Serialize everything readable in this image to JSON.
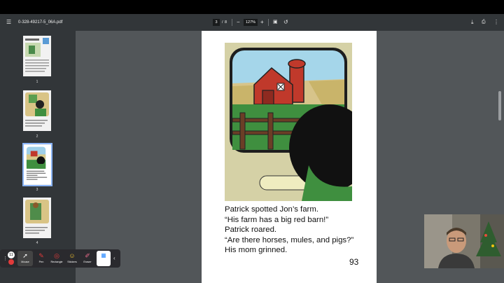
{
  "pdf_toolbar": {
    "filename": "0-328-49217-5_06A.pdf",
    "current_page": "3",
    "page_separator": "/",
    "total_pages": "8",
    "zoom_level": "127%",
    "icons": [
      "menu-icon",
      "zoom-out-icon",
      "zoom-in-icon",
      "fit-page-icon",
      "rotate-icon",
      "download-icon",
      "print-icon",
      "more-icon"
    ]
  },
  "thumbnails": [
    {
      "number": "1"
    },
    {
      "number": "2"
    },
    {
      "number": "3",
      "selected": true
    },
    {
      "number": "4"
    }
  ],
  "page": {
    "story_lines": [
      "Patrick spotted Jon’s farm.",
      "“His farm has a big red barn!”",
      "Patrick roared.",
      "“Are there horses, mules, and pigs?”",
      "His mom grinned."
    ],
    "page_number": "93"
  },
  "zoom_tools": {
    "badge": "11",
    "tools": [
      {
        "label": "Mouse",
        "icon": "cursor-icon"
      },
      {
        "label": "Pen",
        "icon": "pen-icon"
      },
      {
        "label": "Rectangle",
        "icon": "rectangle-icon"
      },
      {
        "label": "Stickers",
        "icon": "sticker-icon"
      },
      {
        "label": "Eraser",
        "icon": "eraser-icon"
      },
      {
        "label": "",
        "icon": "app-icon"
      }
    ],
    "colors": {
      "pen": "#e23b3b",
      "accent": "#2d8cff"
    }
  }
}
